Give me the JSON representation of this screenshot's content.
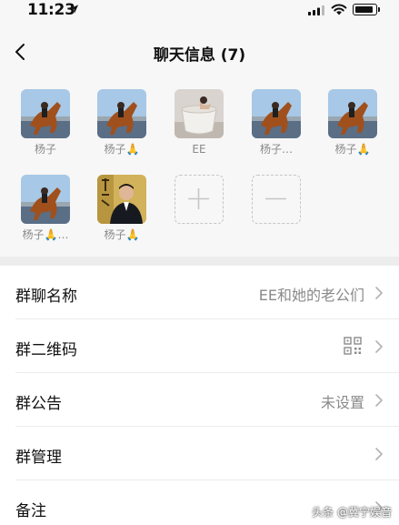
{
  "status_bar": {
    "time": "11:23",
    "icons": [
      "location-arrow-icon",
      "cellular-signal-icon",
      "wifi-icon",
      "battery-icon"
    ]
  },
  "nav": {
    "back_icon": "chevron-left-icon",
    "title": "聊天信息 (7)"
  },
  "members": [
    {
      "name": "杨子",
      "avatar": "horse-rider-photo"
    },
    {
      "name": "杨子🙏",
      "avatar": "horse-rider-photo"
    },
    {
      "name": "EE",
      "avatar": "woman-in-cup-photo"
    },
    {
      "name": "杨子…",
      "avatar": "horse-rider-photo"
    },
    {
      "name": "杨子🙏",
      "avatar": "horse-rider-photo"
    },
    {
      "name": "杨子🙏…",
      "avatar": "horse-rider-photo"
    },
    {
      "name": "杨子🙏",
      "avatar": "man-in-suit-photo"
    }
  ],
  "member_actions": {
    "add_icon": "plus-icon",
    "remove_icon": "minus-icon"
  },
  "settings": [
    {
      "label": "群聊名称",
      "value": "EE和她的老公们"
    },
    {
      "label": "群二维码",
      "value": "",
      "icon": "qr-code-icon"
    },
    {
      "label": "群公告",
      "value": "未设置"
    },
    {
      "label": "群管理",
      "value": ""
    },
    {
      "label": "备注",
      "value": ""
    }
  ],
  "watermark": "头条 @冀宁娱音",
  "colors": {
    "header_bg": "#f7f7f7",
    "page_bg": "#ededed",
    "list_bg": "#ffffff",
    "secondary_text": "#8a8a8a"
  }
}
